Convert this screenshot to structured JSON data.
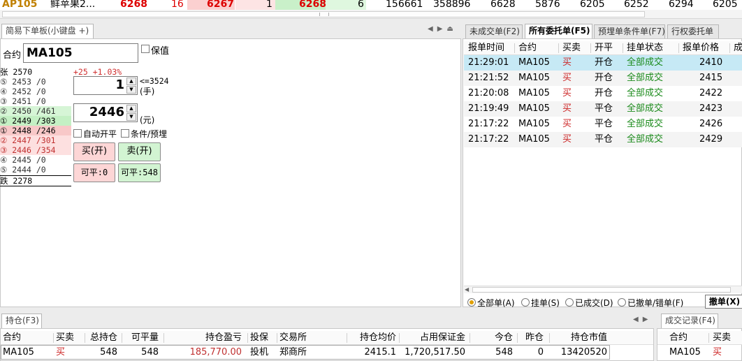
{
  "quote": {
    "symbol": "AP105",
    "name": "鲜苹果2...",
    "last": "6268",
    "change_vol": "16",
    "bid": "6267",
    "bid_vol": "1",
    "ask": "6268",
    "ask_vol": "6",
    "volume": "156661",
    "open_interest": "358896",
    "f1": "6628",
    "f2": "5876",
    "f3": "6205",
    "f4": "6252",
    "f5": "6294",
    "f6": "6205"
  },
  "order_panel": {
    "tab": "简易下单板(小键盘 +)",
    "contract_label": "合约",
    "contract": "MA105",
    "hedge_label": "保值",
    "change": "+25 +1.03%",
    "qty": "1",
    "qty_max": "<=3524",
    "qty_unit": "(手)",
    "price": "2446",
    "price_unit": "(元)",
    "auto_open_close": "自动开平",
    "condition_label": "条件/预埋",
    "buy_label": "买(开)",
    "sell_label": "卖(开)",
    "closable_buy": "可平:0",
    "closable_sell": "可平:548",
    "limit_up": "张 2570",
    "limit_down": "跌 2278",
    "ladder": [
      {
        "text": "⑤ 2453 /0",
        "bg": "#ffffff",
        "color": "#333333"
      },
      {
        "text": "④ 2452 /0",
        "bg": "#ffffff",
        "color": "#333333"
      },
      {
        "text": "③ 2451 /0",
        "bg": "#ffffff",
        "color": "#333333"
      },
      {
        "text": "② 2450 /461",
        "bg": "#d6f5d6",
        "color": "#333333"
      },
      {
        "text": "① 2449 /303",
        "bg": "#c4f0c4",
        "color": "#000000"
      },
      {
        "text": "① 2448 /246",
        "bg": "#f8c8c8",
        "color": "#000000"
      },
      {
        "text": "② 2447 /301",
        "bg": "#fde0e0",
        "color": "#c03030"
      },
      {
        "text": "③ 2446 /354",
        "bg": "#fde0e0",
        "color": "#c03030"
      },
      {
        "text": "④ 2445 /0",
        "bg": "#ffffff",
        "color": "#333333"
      },
      {
        "text": "⑤ 2444 /0",
        "bg": "#ffffff",
        "color": "#333333"
      }
    ]
  },
  "orders": {
    "tabs": [
      "未成交单(F2)",
      "所有委托单(F5)",
      "预埋单条件单(F7)",
      "行权委托单"
    ],
    "headers": [
      "报单时间",
      "合约",
      "买卖",
      "开平",
      "挂单状态",
      "报单价格",
      "成"
    ],
    "rows": [
      [
        "21:29:01",
        "MA105",
        "买",
        "开仓",
        "全部成交",
        "2410"
      ],
      [
        "21:21:52",
        "MA105",
        "买",
        "开仓",
        "全部成交",
        "2415"
      ],
      [
        "21:20:08",
        "MA105",
        "买",
        "开仓",
        "全部成交",
        "2422"
      ],
      [
        "21:19:49",
        "MA105",
        "买",
        "平仓",
        "全部成交",
        "2423"
      ],
      [
        "21:17:22",
        "MA105",
        "买",
        "平仓",
        "全部成交",
        "2426"
      ],
      [
        "21:17:22",
        "MA105",
        "买",
        "平仓",
        "全部成交",
        "2429"
      ]
    ],
    "filters": [
      "全部单(A)",
      "挂单(S)",
      "已成交(D)",
      "已撤单/错单(F)"
    ],
    "cancel_label": "撤单(X)"
  },
  "positions": {
    "tab": "持仓(F3)",
    "headers": [
      "合约",
      "买卖",
      "总持仓",
      "可平量",
      "持仓盈亏",
      "投保",
      "交易所",
      "持仓均价",
      "占用保证金",
      "今仓",
      "昨仓",
      "持仓市值"
    ],
    "row": [
      "MA105",
      "买",
      "548",
      "548",
      "185,770.00",
      "投机",
      "郑商所",
      "2415.1",
      "1,720,517.50",
      "548",
      "0",
      "13420520"
    ]
  },
  "trades": {
    "tab": "成交记录(F4)",
    "headers": [
      "合约",
      "买卖"
    ],
    "row": [
      "MA105",
      "买"
    ]
  },
  "colors": {
    "buy_red": "#cc2222",
    "status_green": "#1a8a1a",
    "selected_row": "#c6e9f5"
  }
}
